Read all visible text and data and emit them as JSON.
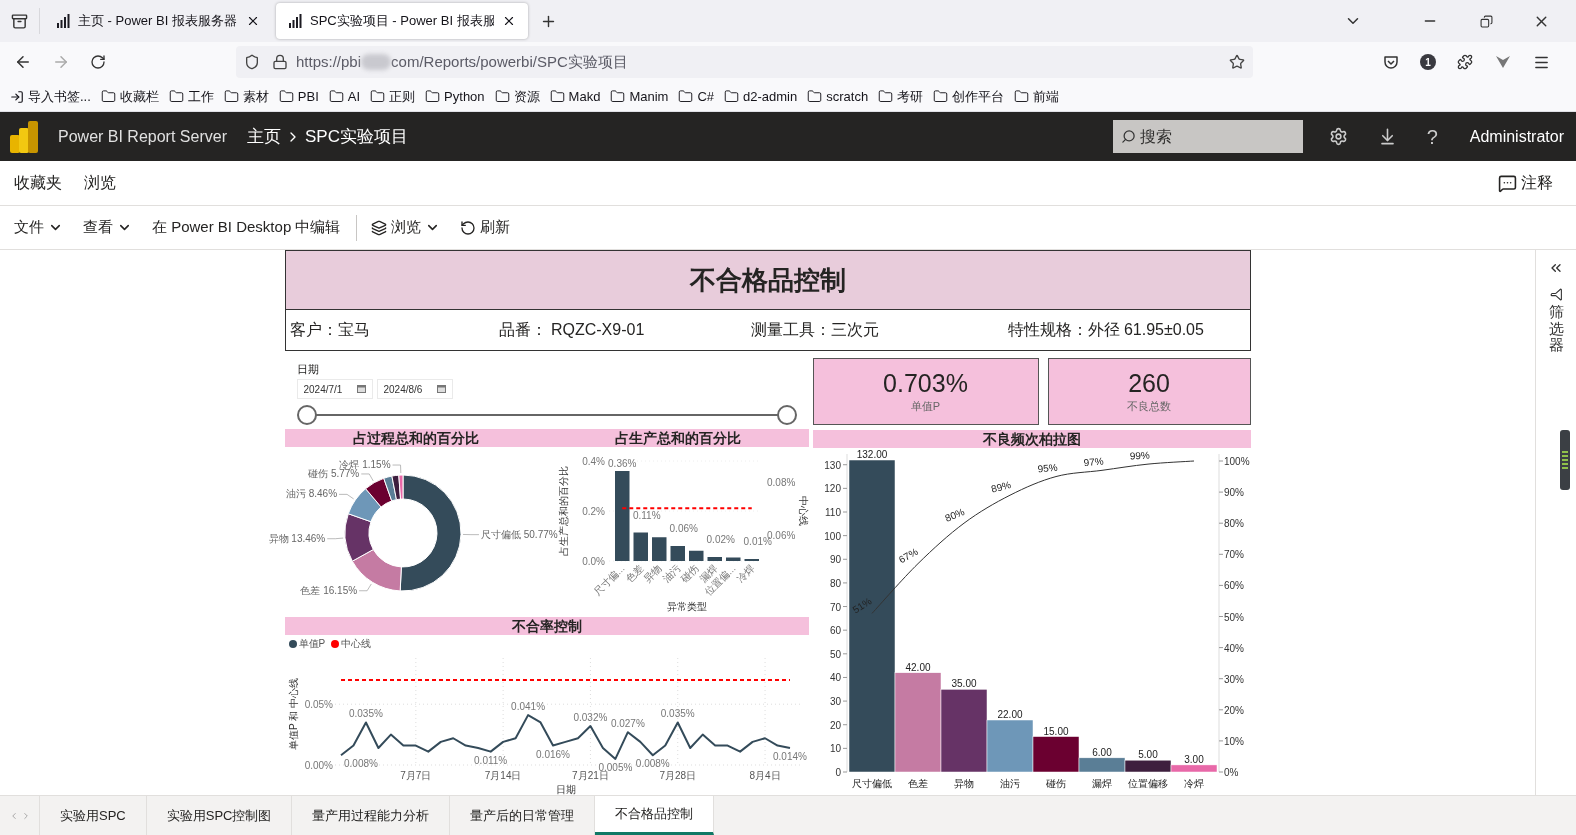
{
  "browser": {
    "tabs": [
      {
        "title": "主页 - Power BI 报表服务器",
        "selected": false
      },
      {
        "title": "SPC实验项目 - Power BI 报表服",
        "selected": true
      }
    ],
    "url_start": "https://pbi",
    "url_end": "com/Reports/powerbi/SPC实验项目",
    "account_badge": "1",
    "bookmarks": [
      {
        "label": "导入书签...",
        "kind": "import"
      },
      {
        "label": "收藏栏",
        "kind": "folder"
      },
      {
        "label": "工作",
        "kind": "folder"
      },
      {
        "label": "素材",
        "kind": "folder"
      },
      {
        "label": "PBI",
        "kind": "folder"
      },
      {
        "label": "AI",
        "kind": "folder"
      },
      {
        "label": "正则",
        "kind": "folder"
      },
      {
        "label": "Python",
        "kind": "folder"
      },
      {
        "label": "资源",
        "kind": "folder"
      },
      {
        "label": "Makd",
        "kind": "folder"
      },
      {
        "label": "Manim",
        "kind": "folder"
      },
      {
        "label": "C#",
        "kind": "folder"
      },
      {
        "label": "d2-admin",
        "kind": "folder"
      },
      {
        "label": "scratch",
        "kind": "folder"
      },
      {
        "label": "考研",
        "kind": "folder"
      },
      {
        "label": "创作平台",
        "kind": "folder"
      },
      {
        "label": "前端",
        "kind": "folder"
      }
    ]
  },
  "header": {
    "product": "Power BI Report Server",
    "breadcrumb": [
      "主页",
      "SPC实验项目"
    ],
    "search": {
      "placeholder": "搜索"
    },
    "help": "?",
    "user": "Administrator"
  },
  "nav": {
    "links": [
      "收藏夹",
      "浏览"
    ],
    "comments": "注释"
  },
  "toolbar": {
    "left": [
      {
        "label": "文件",
        "kind": "menu"
      },
      {
        "label": "查看",
        "kind": "menu"
      },
      {
        "label": "在 Power BI Desktop 中编辑",
        "kind": "button"
      }
    ],
    "right": [
      {
        "label": "浏览",
        "kind": "view"
      },
      {
        "label": "刷新",
        "kind": "refresh"
      }
    ]
  },
  "report": {
    "title": "不合格品控制",
    "info": [
      "客户：宝马",
      "品番： RQZC-X9-01",
      "测量工具：三次元",
      "特性规格：外径 61.95±0.05"
    ],
    "date_slicer": {
      "title": "日期",
      "start": "2024/7/1",
      "end": "2024/8/6",
      "start_thumb": {
        "level": 0
      },
      "end_thumb": {
        "level": 1
      }
    },
    "cards": [
      {
        "value": "0.703%",
        "label": "单值P"
      },
      {
        "value": "260",
        "label": "不良总数"
      }
    ],
    "process_share": {
      "title": "占过程总和的百分比",
      "chart_data": {
        "type": "donut",
        "categories": [
          "尺寸偏低",
          "色差",
          "异物",
          "油污",
          "碰伤",
          null,
          null,
          "冷焊"
        ],
        "values": [
          50.77,
          16.15,
          13.46,
          8.46,
          5.77,
          2.31,
          1.92,
          1.15
        ],
        "colors": [
          "#344b5a",
          "#c57ba3",
          "#663366",
          "#6e97b8",
          "#6b0030",
          "#5a7e96",
          "#3e1f3e",
          "#e868a8"
        ],
        "value_labels": [
          "50.77%",
          "16.15%",
          "13.46%",
          "8.46%",
          "5.77%",
          null,
          null,
          "1.15%"
        ]
      }
    },
    "production_share": {
      "title": "占生产总和的百分比",
      "chart_data": {
        "type": "bar",
        "xlabel": "异常类型",
        "ylabel": "占生产总和的百分比",
        "categories": [
          "尺寸偏...",
          "色差",
          "异物",
          "油污",
          "碰伤",
          "漏焊",
          "位置偏...",
          "冷焊"
        ],
        "series": [
          {
            "color": "#344b5a",
            "values": [
              0.36,
              0.114,
              0.095,
              0.06,
              0.041,
              0.016,
              0.014,
              0.008
            ]
          },
          {
            "name": "中心线",
            "color": "#ff0000",
            "type": "line",
            "axis": "y2",
            "line_style": "dashed",
            "values": [
              0.07,
              0.07,
              0.07,
              0.07,
              0.07,
              0.07,
              0.07,
              0.07
            ]
          }
        ],
        "ylim": [
          0,
          0.4
        ],
        "yticks": [
          {
            "value": 0,
            "label": "0.0%"
          },
          {
            "value": 0.2,
            "label": "0.2%"
          },
          {
            "value": 0.4,
            "label": "0.4%"
          }
        ],
        "y2lim": [
          0.05,
          0.088
        ],
        "y2ticks": [
          {
            "value": 0.06,
            "label": "0.06%"
          },
          {
            "value": 0.08,
            "label": "0.08%"
          }
        ],
        "value_labels": [
          "0.36%",
          "0.11%",
          null,
          "0.06%",
          null,
          "0.02%",
          null,
          "0.01%"
        ]
      }
    },
    "rate_control": {
      "title": "不合率控制",
      "chart_data": {
        "type": "line",
        "xlabel": "日期",
        "ylabel": "单值P 和 中心线",
        "categories": [
          null,
          null,
          null,
          null,
          null,
          null,
          "7月7日",
          null,
          null,
          null,
          null,
          null,
          null,
          "7月14日",
          null,
          null,
          null,
          null,
          null,
          null,
          "7月21日",
          null,
          null,
          null,
          null,
          null,
          null,
          "7月28日",
          null,
          null,
          null,
          null,
          null,
          null,
          "8月4日",
          null,
          null
        ],
        "series": [
          {
            "name": "单值P",
            "color": "#344b5a",
            "values": [
              0.008,
              0.016,
              0.035,
              0.014,
              0.025,
              0.016,
              0.016,
              0.011,
              0.019,
              0.022,
              0.016,
              0.014,
              0.011,
              0.019,
              0.022,
              0.041,
              0.035,
              0.016,
              0.019,
              0.022,
              0.032,
              0.014,
              0.005,
              0.027,
              0.019,
              0.008,
              0.016,
              0.035,
              0.014,
              0.025,
              0.016,
              0.016,
              0.011,
              0.019,
              0.022,
              0.016,
              0.014
            ]
          },
          {
            "name": "中心线",
            "color": "#ff0000",
            "line_style": "dashed",
            "values": [
              0.07,
              0.07,
              0.07,
              0.07,
              0.07,
              0.07,
              0.07,
              0.07,
              0.07,
              0.07,
              0.07,
              0.07,
              0.07,
              0.07,
              0.07,
              0.07,
              0.07,
              0.07,
              0.07,
              0.07,
              0.07,
              0.07,
              0.07,
              0.07,
              0.07,
              0.07,
              0.07,
              0.07,
              0.07,
              0.07,
              0.07,
              0.07,
              0.07,
              0.07,
              0.07,
              0.07,
              0.07
            ]
          }
        ],
        "ylim": [
          0,
          0.088
        ],
        "grid": true,
        "yticks": [
          {
            "value": 0,
            "label": "0.00%"
          },
          {
            "value": 0.05,
            "label": "0.05%"
          }
        ],
        "value_labels": [
          "0.008%",
          null,
          "0.035%",
          null,
          null,
          null,
          null,
          null,
          null,
          null,
          null,
          null,
          "0.011%",
          null,
          null,
          "0.041%",
          null,
          "0.016%",
          null,
          null,
          "0.032%",
          null,
          "0.005%",
          "0.027%",
          null,
          "0.008%",
          null,
          "0.035%",
          null,
          null,
          null,
          null,
          null,
          null,
          null,
          null,
          "0.014%"
        ]
      }
    },
    "pareto": {
      "title": "不良频次柏拉图",
      "chart_data": {
        "type": "bar",
        "categories": [
          "尺寸偏低",
          "色差",
          "异物",
          "油污",
          "碰伤",
          "漏焊",
          "位置偏移",
          "冷焊"
        ],
        "series": [
          {
            "type": "bar",
            "colors": [
              "#344b5a",
              "#c57ba3",
              "#663366",
              "#6e97b8",
              "#6b0030",
              "#5a7e96",
              "#3e1f3e",
              "#e868a8"
            ],
            "values": [
              132,
              42,
              35,
              22,
              15,
              6,
              5,
              3
            ]
          },
          {
            "type": "line",
            "color": "#333333",
            "axis": "y2",
            "values": [
              51,
              67,
              80,
              89,
              95,
              97,
              99,
              100
            ],
            "value_labels": [
              "51%",
              "67%",
              "80%",
              "89%",
              "95%",
              "97%",
              "99%",
              null
            ]
          }
        ],
        "ylim": [
          0,
          132
        ],
        "yticks": [
          0,
          10,
          20,
          30,
          40,
          50,
          60,
          70,
          80,
          90,
          100,
          110,
          120,
          130
        ],
        "y2lim": [
          0,
          100
        ],
        "y2ticks": [
          {
            "value": 0,
            "label": "0%"
          },
          {
            "value": 10,
            "label": "10%"
          },
          {
            "value": 20,
            "label": "20%"
          },
          {
            "value": 30,
            "label": "30%"
          },
          {
            "value": 40,
            "label": "40%"
          },
          {
            "value": 50,
            "label": "50%"
          },
          {
            "value": 60,
            "label": "60%"
          },
          {
            "value": 70,
            "label": "70%"
          },
          {
            "value": 80,
            "label": "80%"
          },
          {
            "value": 90,
            "label": "90%"
          },
          {
            "value": 100,
            "label": "100%"
          }
        ],
        "value_labels": [
          "132.00",
          "42.00",
          "35.00",
          "22.00",
          "15.00",
          "6.00",
          "5.00",
          "3.00"
        ]
      }
    }
  },
  "filter_pane": {
    "label": "筛选器"
  },
  "pages": [
    {
      "label": "实验用SPC",
      "selected": false
    },
    {
      "label": "实验用SPC控制图",
      "selected": false
    },
    {
      "label": "量产用过程能力分析",
      "selected": false
    },
    {
      "label": "量产后的日常管理",
      "selected": false
    },
    {
      "label": "不合格品控制",
      "selected": true
    }
  ]
}
